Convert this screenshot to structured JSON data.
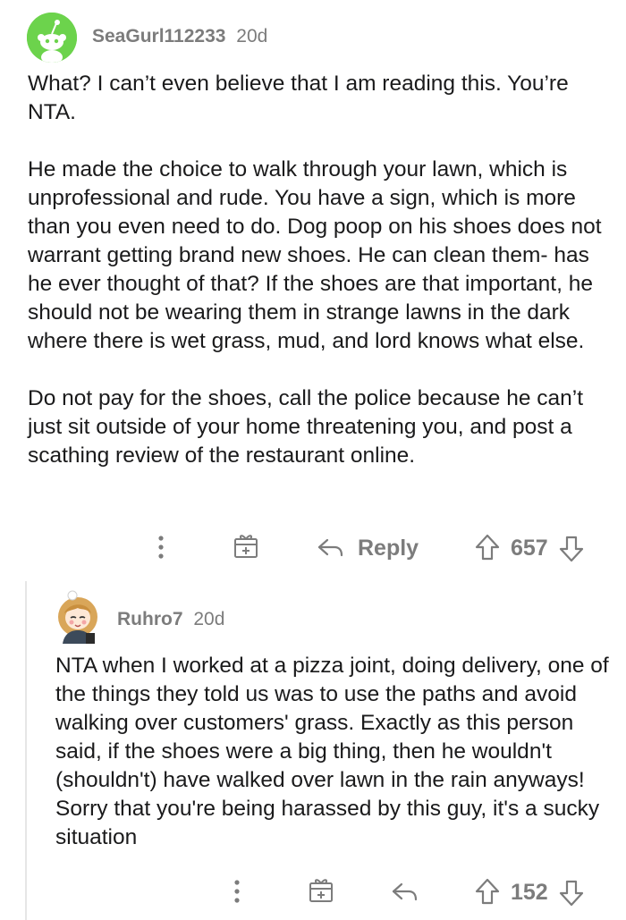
{
  "comments": [
    {
      "username": "SeaGurl112233",
      "time": "20d",
      "paragraphs": [
        "What? I can’t even believe that I am reading this. You’re NTA.",
        "He made the choice to walk through your lawn, which is unprofessional and rude.  You have a sign, which is more than you even need to do.  Dog poop on his shoes does not warrant getting brand new shoes.  He can clean them- has he ever thought of that?  If the shoes are that important, he should not be wearing them in strange lawns in the dark where there is wet grass, mud, and lord knows what else.",
        "Do not pay for the shoes, call the police because he can’t just sit outside of your home threatening you, and post a scathing review of the restaurant online."
      ],
      "reply_label": "Reply",
      "votes": "657",
      "avatar_color": "#6cd34c"
    },
    {
      "username": "Ruhro7",
      "time": "20d",
      "text": "NTA when I worked at a pizza joint, doing delivery, one of the things they told us was to use the paths and avoid walking over customers' grass. Exactly as this person said, if the shoes were a big thing, then he wouldn't (shouldn't) have walked over lawn in the rain anyways! Sorry that you're being harassed by this guy, it's a sucky situation",
      "votes": "152"
    }
  ],
  "icons": {
    "more": "more-icon",
    "award": "award-icon",
    "reply": "reply-icon",
    "upvote": "upvote-icon",
    "downvote": "downvote-icon"
  },
  "colors": {
    "meta_gray": "#7c7c7c",
    "text": "#1a1a1b",
    "thread_line": "#e6e6e6"
  }
}
